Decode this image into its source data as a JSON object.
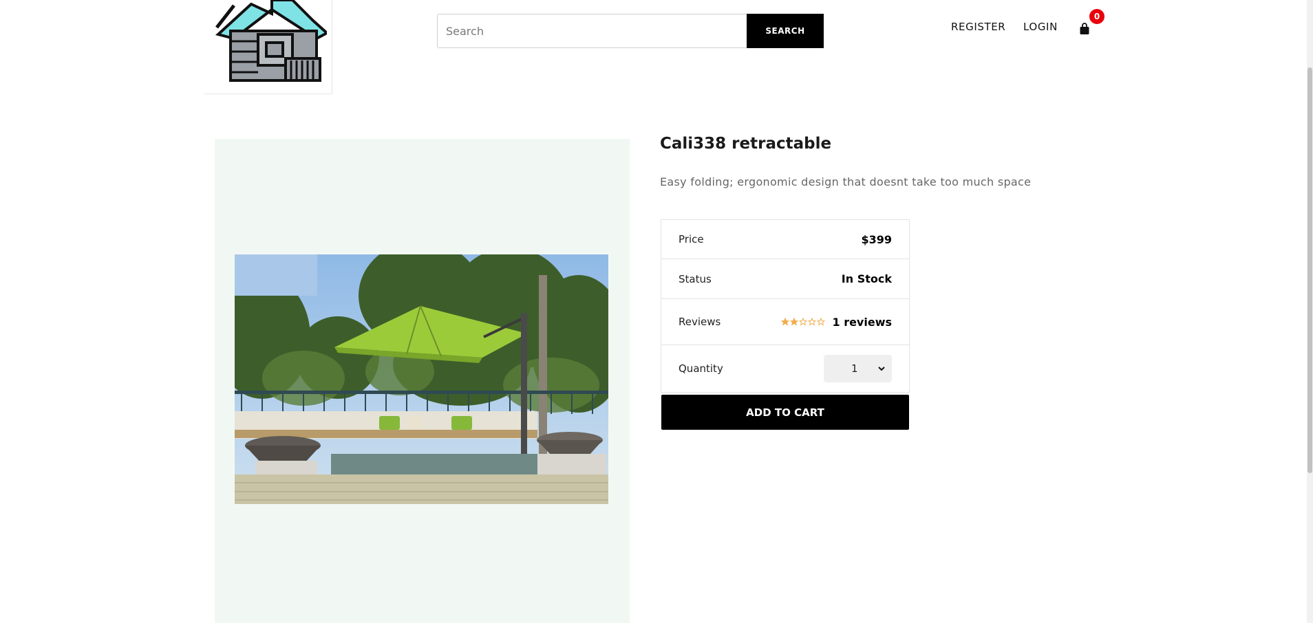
{
  "header": {
    "search_placeholder": "Search",
    "search_button": "SEARCH",
    "register": "REGISTER",
    "login": "LOGIN",
    "cart_count": "0",
    "icons": [
      "house-logo-icon",
      "shopping-bag-icon"
    ]
  },
  "product": {
    "title": "Cali338 retractable",
    "description": "Easy folding; ergonomic design that doesnt take too much space",
    "price_label": "Price",
    "price_value": "$399",
    "status_label": "Status",
    "status_value": "In Stock",
    "reviews_label": "Reviews",
    "reviews_text": "1 reviews",
    "rating": 2,
    "rating_max": 5,
    "quantity_label": "Quantity",
    "quantity_value": "1",
    "add_to_cart": "ADD TO CART"
  },
  "colors": {
    "accent": "#000000",
    "badge": "#e8000b",
    "image_panel": "#f1f8f3",
    "star": "#f0ad4e"
  }
}
